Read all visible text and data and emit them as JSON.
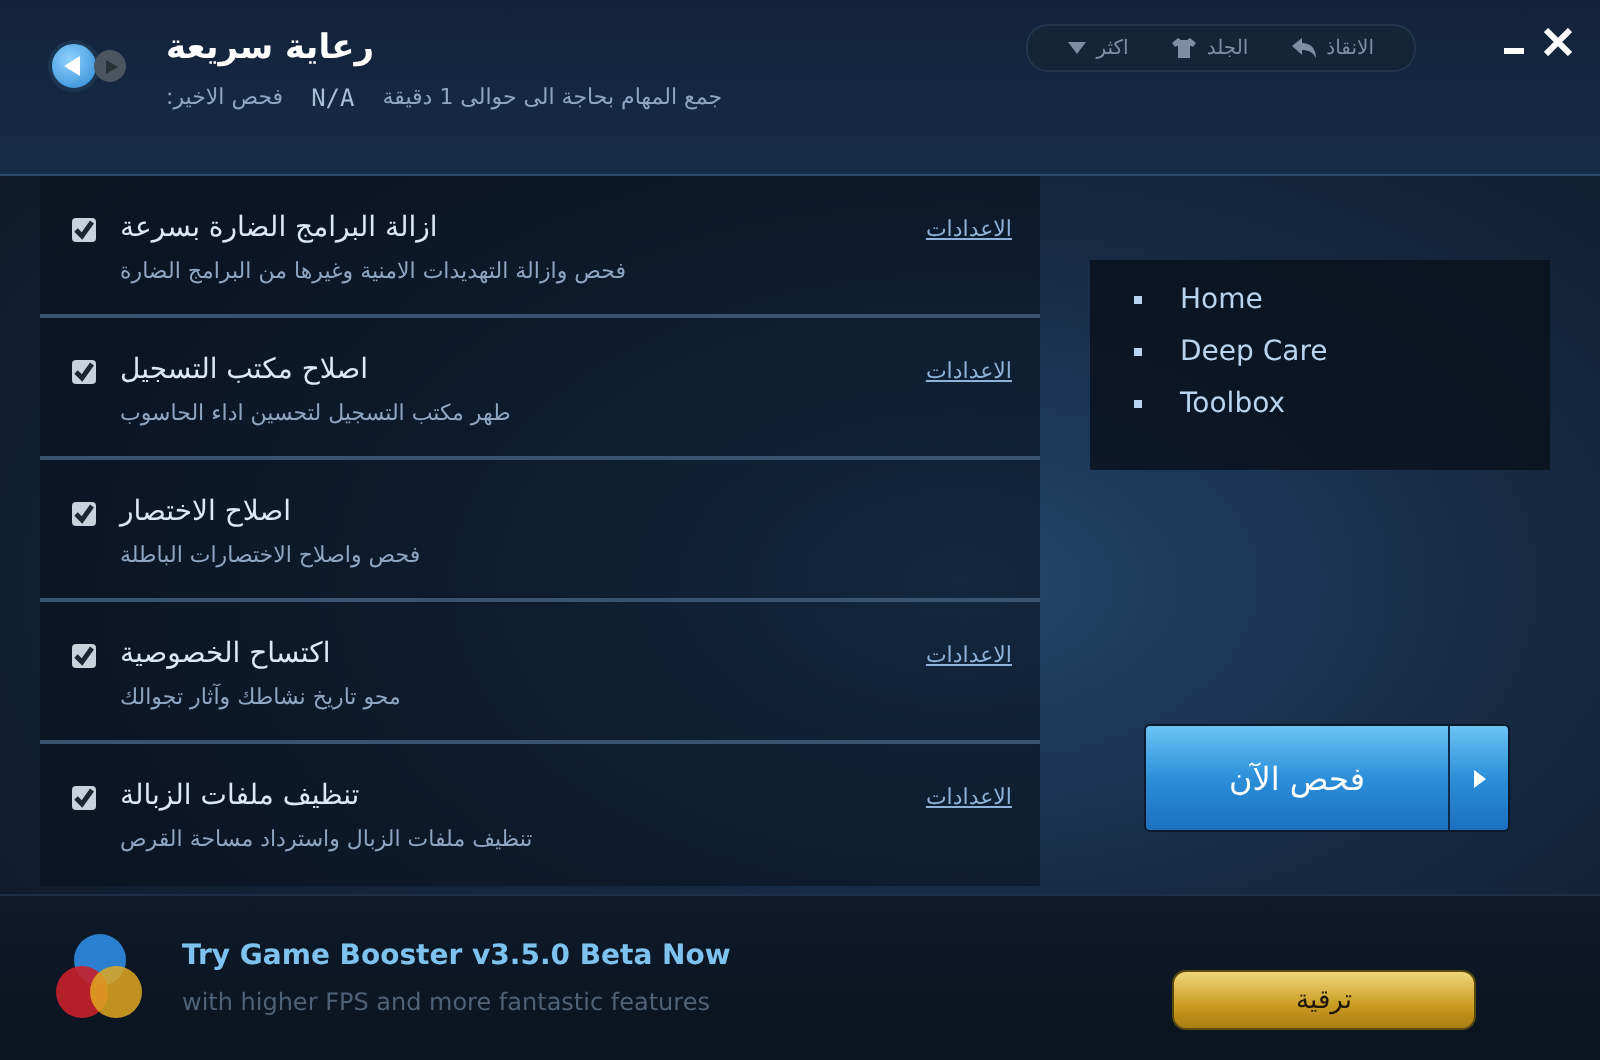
{
  "header": {
    "title": "رعاية سريعة",
    "last_scan_label": "فحص الاخير:",
    "last_scan_value": "N/A",
    "estimate": "جمع المهام بحاجة الى حوالى 1 دقيقة",
    "toolbar": [
      {
        "kind": "rescue",
        "label": "الانقاذ"
      },
      {
        "kind": "skin",
        "label": "الجلد"
      },
      {
        "kind": "more",
        "label": "اكثر"
      }
    ]
  },
  "tasks": [
    {
      "title": "ازالة البرامج الضارة بسرعة",
      "description": "فحص وازالة التهديدات الامنية وغيرها من البرامج الضارة",
      "checked": true,
      "settings": "الاعدادات"
    },
    {
      "title": "اصلاح مكتب التسجيل",
      "description": "طهر مكتب التسجيل لتحسين اداء الحاسوب",
      "checked": true,
      "settings": "الاعدادات"
    },
    {
      "title": "اصلاح الاختصار",
      "description": "فحص واصلاح الاختصارات الباطلة",
      "checked": true
    },
    {
      "title": "اكتساح الخصوصية",
      "description": "محو تاريخ نشاطك وآثار تجوالك",
      "checked": true,
      "settings": "الاعدادات"
    },
    {
      "title": "تنظيف ملفات الزبالة",
      "description": "تنظيف ملفات الزبال واسترداد مساحة القرص",
      "checked": true,
      "settings": "الاعدادات"
    }
  ],
  "nav": {
    "items": [
      "Home",
      "Deep Care",
      "Toolbox"
    ]
  },
  "scan_button": {
    "label": "فحص الآن"
  },
  "promo": {
    "title": "Try Game Booster v3.5.0 Beta Now",
    "subtitle": "with higher FPS and more fantastic features",
    "button": "ترقية"
  }
}
